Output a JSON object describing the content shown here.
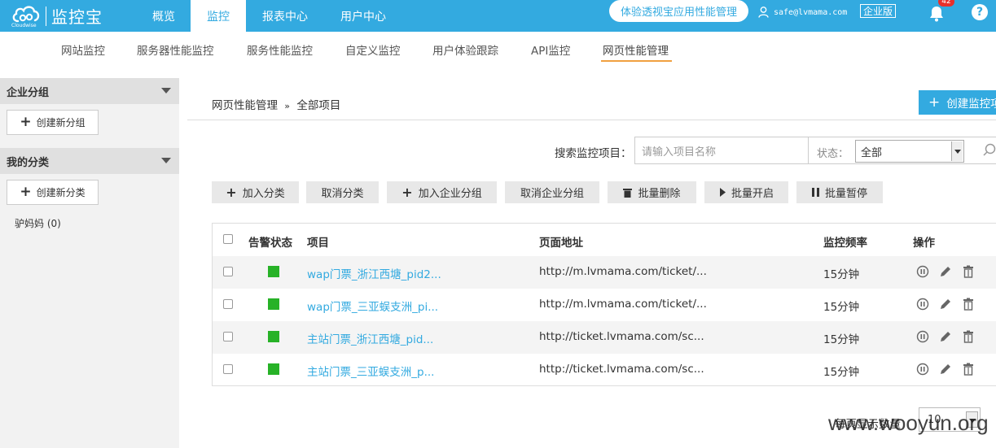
{
  "brand": {
    "name": "监控宝",
    "sub": "Cloudwise"
  },
  "topnav": [
    {
      "label": "概览",
      "active": false
    },
    {
      "label": "监控",
      "active": true
    },
    {
      "label": "报表中心",
      "active": false
    },
    {
      "label": "用户中心",
      "active": false
    }
  ],
  "promo_pill": "体验透视宝应用性能管理",
  "user_email": "safe@lvmama.com",
  "edition": "企业版",
  "notification_count": "42",
  "help": "?",
  "subtabs": [
    "网站监控",
    "服务器性能监控",
    "服务性能监控",
    "自定义监控",
    "用户体验跟踪",
    "API监控",
    "网页性能管理"
  ],
  "active_subtab": "网页性能管理",
  "sidebar": {
    "group_title": "企业分组",
    "group_button": "创建新分组",
    "category_title": "我的分类",
    "category_button": "创建新分类",
    "items": [
      "驴妈妈 (0)"
    ]
  },
  "breadcrumb": {
    "parent": "网页性能管理",
    "sep": "»",
    "current": "全部项目"
  },
  "create_button": "创建监控项",
  "search": {
    "label": "搜索监控项目：",
    "placeholder": "请输入项目名称"
  },
  "status_filter": {
    "label": "状态：",
    "value": "全部"
  },
  "actions": [
    "加入分类",
    "取消分类",
    "加入企业分组",
    "取消企业分组",
    "批量删除",
    "批量开启",
    "批量暂停"
  ],
  "table": {
    "headers": [
      "告警状态",
      "项目",
      "页面地址",
      "监控频率",
      "操作"
    ],
    "rows": [
      {
        "name": "wap门票_浙江西塘_pid2...",
        "url": "http://m.lvmama.com/ticket/...",
        "freq": "15分钟",
        "status_color": "#27b227"
      },
      {
        "name": "wap门票_三亚蜈支洲_pi...",
        "url": "http://m.lvmama.com/ticket/...",
        "freq": "15分钟",
        "status_color": "#27b227"
      },
      {
        "name": "主站门票_浙江西塘_pid...",
        "url": "http://ticket.lvmama.com/sc...",
        "freq": "15分钟",
        "status_color": "#27b227"
      },
      {
        "name": "主站门票_三亚蜈支洲_p...",
        "url": "http://ticket.lvmama.com/sc...",
        "freq": "15分钟",
        "status_color": "#27b227"
      }
    ]
  },
  "per_page": {
    "label": "每页显示数量",
    "value": "10"
  },
  "watermark": "www.wooyun.org"
}
